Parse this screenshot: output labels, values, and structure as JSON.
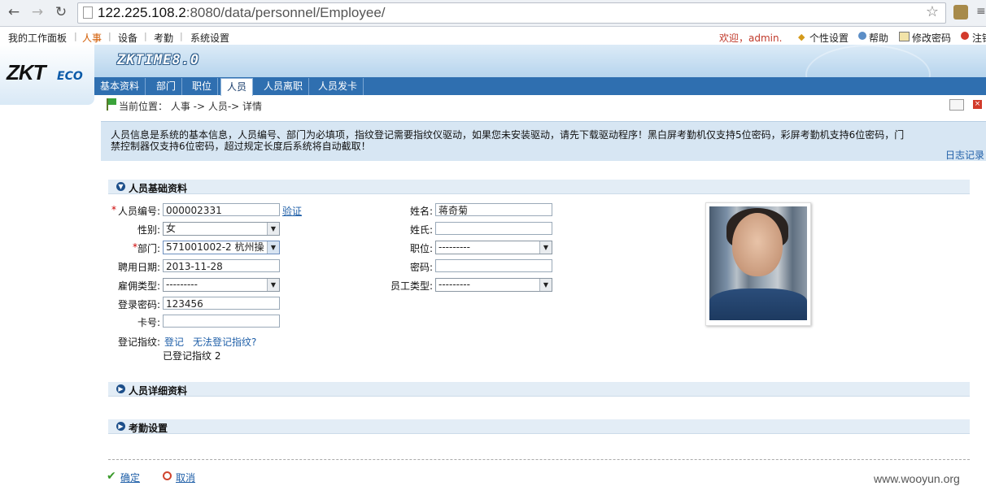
{
  "browser": {
    "url_host": "122.225.108.2",
    "url_rest": ":8080/data/personnel/Employee/"
  },
  "top_menu": {
    "items": [
      "我的工作面板",
      "人事",
      "设备",
      "考勤",
      "系统设置"
    ],
    "welcome": "欢迎，admin.",
    "personal": "个性设置",
    "help": "帮助",
    "change_password": "修改密码",
    "logout": "注销"
  },
  "header": {
    "logo": "ZKT",
    "logo_sub": "ECO",
    "app_title": "ZKTIME8.0"
  },
  "tabs": [
    "基本资料",
    "部门",
    "职位",
    "人员",
    "人员离职",
    "人员发卡"
  ],
  "breadcrumb": "当前位置： 人事 -> 人员-> 详情",
  "info": {
    "text": "人员信息是系统的基本信息，人员编号、部门为必填项，指纹登记需要指纹仪驱动，如果您未安装驱动，请先下载驱动程序！黑白屏考勤机仅支持5位密码，彩屏考勤机支持6位密码，门禁控制器仅支持6位密码，超过规定长度后系统将自动截取！",
    "log_link": "日志记录"
  },
  "sections": {
    "basic": "人员基础资料",
    "detail": "人员详细资料",
    "attendance": "考勤设置"
  },
  "form": {
    "emp_no_label": "人员编号:",
    "emp_no": "000002331",
    "verify": "验证",
    "gender_label": "性别:",
    "gender": "女",
    "dept_label": "部门:",
    "dept": "571001002-2 杭州操",
    "hire_date_label": "聘用日期:",
    "hire_date": "2013-11-28",
    "emp_type_label": "雇佣类型:",
    "emp_type": "---------",
    "login_pwd_label": "登录密码:",
    "login_pwd": "123456",
    "card_label": "卡号:",
    "card": "",
    "fp_label": "登记指纹:",
    "fp_register": "登记",
    "fp_cannot": "无法登记指纹?",
    "fp_registered": "已登记指纹 2",
    "name_label": "姓名:",
    "name": "蒋奇菊",
    "surname_label": "姓氏:",
    "surname": "",
    "position_label": "职位:",
    "position": "---------",
    "password_label": "密码:",
    "password": "",
    "staff_type_label": "员工类型:",
    "staff_type": "---------"
  },
  "footer": {
    "confirm": "确定",
    "cancel": "取消",
    "watermark": "www.wooyun.org"
  }
}
